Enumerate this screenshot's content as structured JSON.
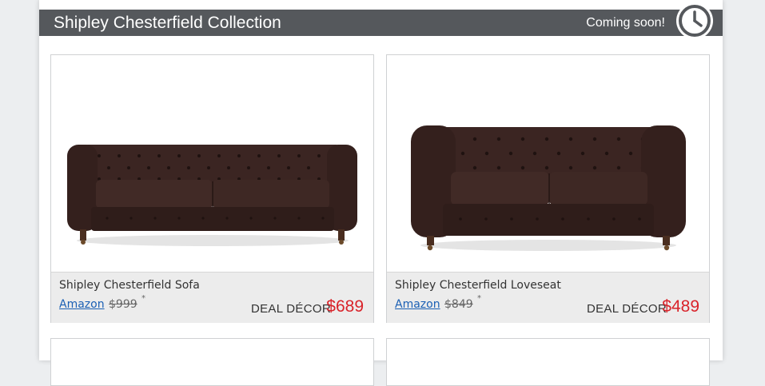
{
  "header": {
    "title": "Shipley Chesterfield Collection",
    "status": "Coming soon!",
    "status_icon": "clock-icon",
    "bar_color": "#55585c"
  },
  "products": [
    {
      "name": "Shipley Chesterfield Sofa",
      "retailer": "Amazon",
      "original_price": "$999",
      "footnote_mark": "*",
      "brand": "DEAL DÉCOR",
      "deal_price": "$689",
      "image": "chesterfield-sofa-image"
    },
    {
      "name": "Shipley Chesterfield Loveseat",
      "retailer": "Amazon",
      "original_price": "$849",
      "footnote_mark": "*",
      "brand": "DEAL DÉCOR",
      "deal_price": "$489",
      "image": "chesterfield-loveseat-image"
    }
  ],
  "colors": {
    "price_red": "#d9232a",
    "link_blue": "#1a5fb4",
    "leather_brown": "#3a2320"
  }
}
